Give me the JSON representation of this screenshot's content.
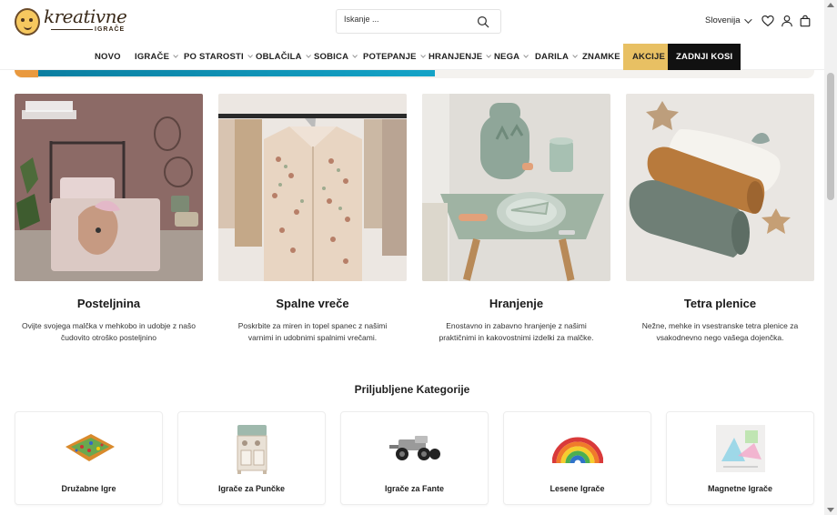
{
  "brand": {
    "logo_word": "kreativne",
    "logo_sub": "IGRAČE"
  },
  "search": {
    "placeholder": "Iskanje ..."
  },
  "header": {
    "language": "Slovenija"
  },
  "nav": {
    "items": [
      {
        "label": "NOVO",
        "dropdown": false
      },
      {
        "label": "IGRAČE",
        "dropdown": true
      },
      {
        "label": "PO STAROSTI",
        "dropdown": true
      },
      {
        "label": "OBLAČILA",
        "dropdown": true
      },
      {
        "label": "SOBICA",
        "dropdown": true
      },
      {
        "label": "POTEPANJE",
        "dropdown": true
      },
      {
        "label": "HRANJENJE",
        "dropdown": true
      },
      {
        "label": "NEGA",
        "dropdown": true
      },
      {
        "label": "DARILA",
        "dropdown": true
      },
      {
        "label": "ZNAMKE",
        "dropdown": false
      },
      {
        "label": "AKCIJE",
        "dropdown": false
      },
      {
        "label": "ZADNJI KOSI",
        "dropdown": false
      }
    ]
  },
  "categories": [
    {
      "title": "Posteljnina",
      "description": "Ovijte svojega malčka v mehkobo in udobje z našo čudovito otroško posteljnino"
    },
    {
      "title": "Spalne vreče",
      "description": "Poskrbite za miren in topel spanec z našimi varnimi in udobnimi spalnimi vrečami."
    },
    {
      "title": "Hranjenje",
      "description": "Enostavno in zabavno hranjenje z našimi praktičnimi in kakovostnimi izdelki za malčke."
    },
    {
      "title": "Tetra plenice",
      "description": "Nežne, mehke in vsestranske tetra plenice za vsakodnevno nego vašega dojenčka."
    }
  ],
  "popular": {
    "title": "Priljubljene Kategorije",
    "items": [
      {
        "label": "Družabne Igre"
      },
      {
        "label": "Igrače za Punčke"
      },
      {
        "label": "Igrače za Fante"
      },
      {
        "label": "Lesene Igrače"
      },
      {
        "label": "Magnetne Igrače"
      }
    ]
  },
  "colors": {
    "akcije_bg": "#e8c063",
    "zadnji_bg": "#111111",
    "banner_teal": "#0b7ea0"
  }
}
